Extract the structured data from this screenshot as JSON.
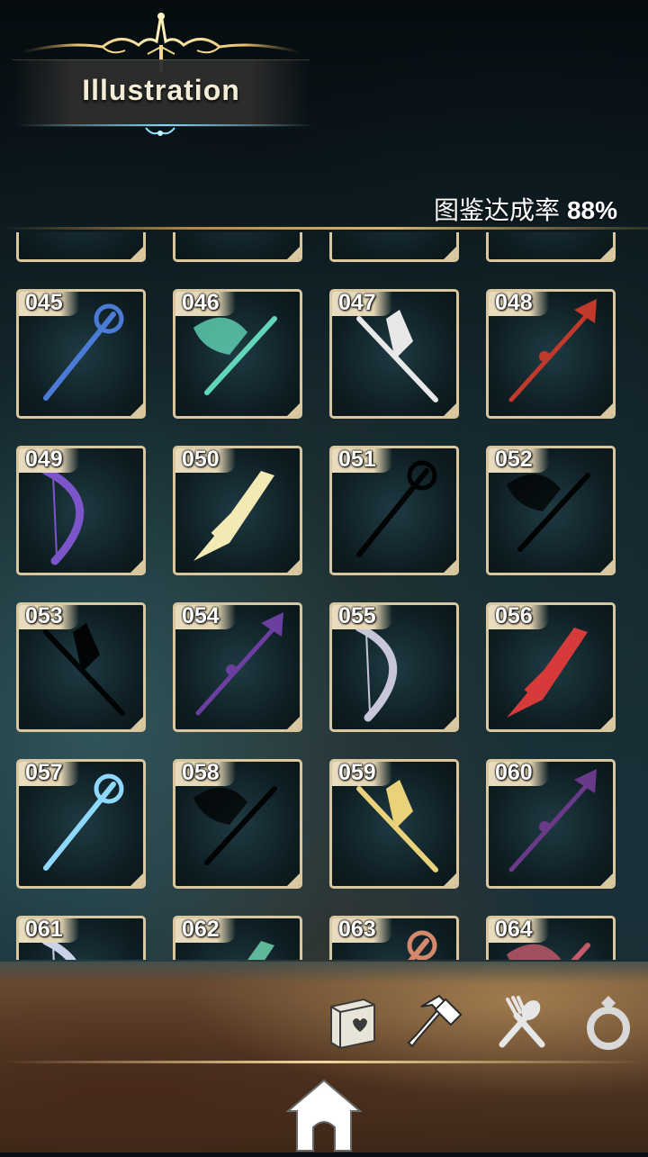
{
  "header": {
    "title": "Illustration",
    "completion_label": "图鉴达成率",
    "completion_value": "88%"
  },
  "grid": {
    "partial_row_top": [
      "",
      "",
      "",
      ""
    ],
    "items": [
      {
        "no": "045",
        "icon": "staff-blue-icon",
        "color": "#4b7bd6",
        "silhouette": false
      },
      {
        "no": "046",
        "icon": "axe-jade-icon",
        "color": "#62d6b8",
        "silhouette": false
      },
      {
        "no": "047",
        "icon": "scythe-white-icon",
        "color": "#e8e8e8",
        "silhouette": false
      },
      {
        "no": "048",
        "icon": "halberd-red-icon",
        "color": "#c0392b",
        "silhouette": false
      },
      {
        "no": "049",
        "icon": "bow-purple-icon",
        "color": "#7b55c9",
        "silhouette": false
      },
      {
        "no": "050",
        "icon": "bow-gold-icon",
        "color": "#f3e9b5",
        "silhouette": false
      },
      {
        "no": "051",
        "icon": "sword-silhouette-icon",
        "color": "#000000",
        "silhouette": true
      },
      {
        "no": "052",
        "icon": "greatsword-silhouette-icon",
        "color": "#000000",
        "silhouette": true
      },
      {
        "no": "053",
        "icon": "wrench-silhouette-icon",
        "color": "#000000",
        "silhouette": true
      },
      {
        "no": "054",
        "icon": "sword-violet-icon",
        "color": "#6a3fa0",
        "silhouette": false
      },
      {
        "no": "055",
        "icon": "spear-silver-icon",
        "color": "#c7c7d9",
        "silhouette": false
      },
      {
        "no": "056",
        "icon": "staff-crimson-icon",
        "color": "#d63a3a",
        "silhouette": false
      },
      {
        "no": "057",
        "icon": "lightning-spear-icon",
        "color": "#8fd8ff",
        "silhouette": false
      },
      {
        "no": "058",
        "icon": "thorn-sword-silhouette-icon",
        "color": "#000000",
        "silhouette": true
      },
      {
        "no": "059",
        "icon": "crescent-blade-icon",
        "color": "#e9d27a",
        "silhouette": false
      },
      {
        "no": "060",
        "icon": "scythe-dark-icon",
        "color": "#6a3a8a",
        "silhouette": false
      },
      {
        "no": "061",
        "icon": "ring-staff-icon",
        "color": "#c9d2e6",
        "silhouette": false
      },
      {
        "no": "062",
        "icon": "jade-staff-icon",
        "color": "#5fb89a",
        "silhouette": false
      },
      {
        "no": "063",
        "icon": "dagger-red-icon",
        "color": "#d48a6a",
        "silhouette": false
      },
      {
        "no": "064",
        "icon": "ornate-mace-icon",
        "color": "#c55a6a",
        "silhouette": false
      }
    ]
  },
  "tabs": [
    {
      "name": "book-tab",
      "icon": "book-icon"
    },
    {
      "name": "hammer-tab",
      "icon": "hammer-icon"
    },
    {
      "name": "cooking-tab",
      "icon": "fork-spoon-icon"
    },
    {
      "name": "ring-tab",
      "icon": "ring-icon"
    }
  ],
  "home": {
    "icon": "home-icon"
  }
}
